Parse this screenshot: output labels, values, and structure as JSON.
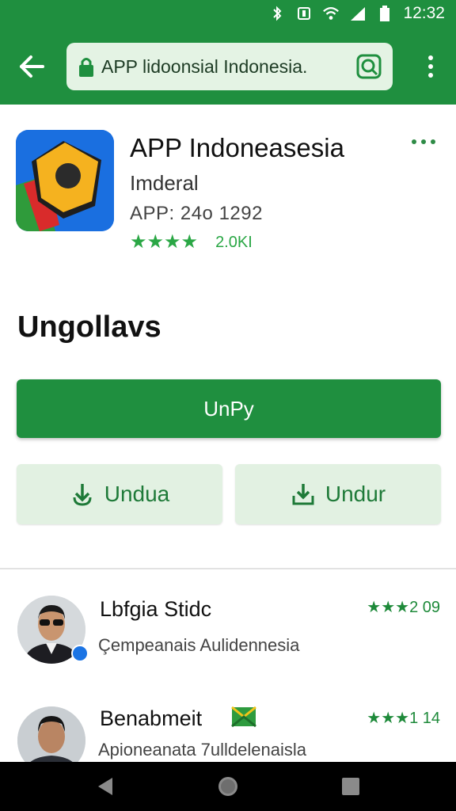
{
  "status_bar": {
    "time": "12:32",
    "icons": [
      "bluetooth-icon",
      "nfc-icon",
      "wifi-icon",
      "signal-icon",
      "battery-icon"
    ]
  },
  "app_bar": {
    "url_text": "APP lidoonsial Indonesia.",
    "icons": [
      "back-arrow-icon",
      "lock-icon",
      "search-icon",
      "more-vert-icon"
    ]
  },
  "app": {
    "title": "APP Indoneasesia",
    "developer": "Imderal",
    "version": "APP: 24o 1292",
    "stars": "★★★★",
    "rating_count": "2.0KI"
  },
  "section": {
    "heading": "Ungollavs"
  },
  "buttons": {
    "primary_label": "UnPy",
    "secondary_left_label": "Undua",
    "secondary_right_label": "Undur"
  },
  "reviews": [
    {
      "name": "Lbfgia Stidc",
      "text": "Çempeanais Aulidennesia",
      "stars_text": "★★★2 09",
      "badge": "verified-icon"
    },
    {
      "name": "Benabmeit",
      "text": "Apioneanata 7ulldelenaisla",
      "stars_text": "★★★1 14",
      "badge": "flag-icon"
    }
  ],
  "nav_bar": {
    "icons": [
      "nav-back-icon",
      "nav-home-icon",
      "nav-recent-icon"
    ]
  },
  "colors": {
    "primary": "#1f8f3f",
    "accent_star": "#2aa745",
    "secondary_bg": "#e2f1e2"
  }
}
